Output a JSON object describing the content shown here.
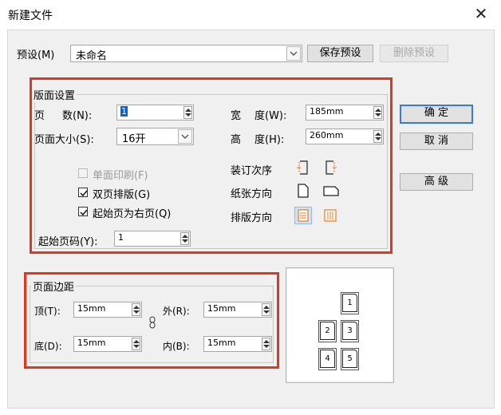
{
  "window": {
    "title": "新建文件",
    "close_label": "✕"
  },
  "preset": {
    "label": "预设(M)",
    "value": "未命名",
    "save_button": "保存预设",
    "delete_button": "删除预设"
  },
  "layout": {
    "title": "版面设置",
    "pages_label_a": "页",
    "pages_label_b": "数(N):",
    "pages_value": "1",
    "size_label": "页面大小(S):",
    "size_value": "16开",
    "width_label_a": "宽",
    "width_label_b": "度(W):",
    "width_value": "185mm",
    "height_label_a": "高",
    "height_label_b": "度(H):",
    "height_value": "260mm",
    "single_print": "单面印刷(F)",
    "facing_pages": "双页排版(G)",
    "start_right": "起始页为右页(Q)",
    "binding_order": "装订次序",
    "orientation": "纸张方向",
    "text_direction": "排版方向",
    "start_page_label": "起始页码(Y):",
    "start_page_value": "1"
  },
  "buttons": {
    "ok": "确 定",
    "cancel": "取 消",
    "advanced": "高 级"
  },
  "margins": {
    "title": "页面边距",
    "top_label": "顶(T):",
    "top_value": "15mm",
    "outer_label": "外(R):",
    "outer_value": "15mm",
    "bottom_label": "底(D):",
    "bottom_value": "15mm",
    "inner_label": "内(B):",
    "inner_value": "15mm"
  },
  "preview": {
    "pages": [
      "1",
      "2",
      "3",
      "4",
      "5"
    ]
  },
  "colors": {
    "highlight": "#e8341f",
    "accent": "#3b79d4",
    "orange_icon": "#f07818"
  }
}
